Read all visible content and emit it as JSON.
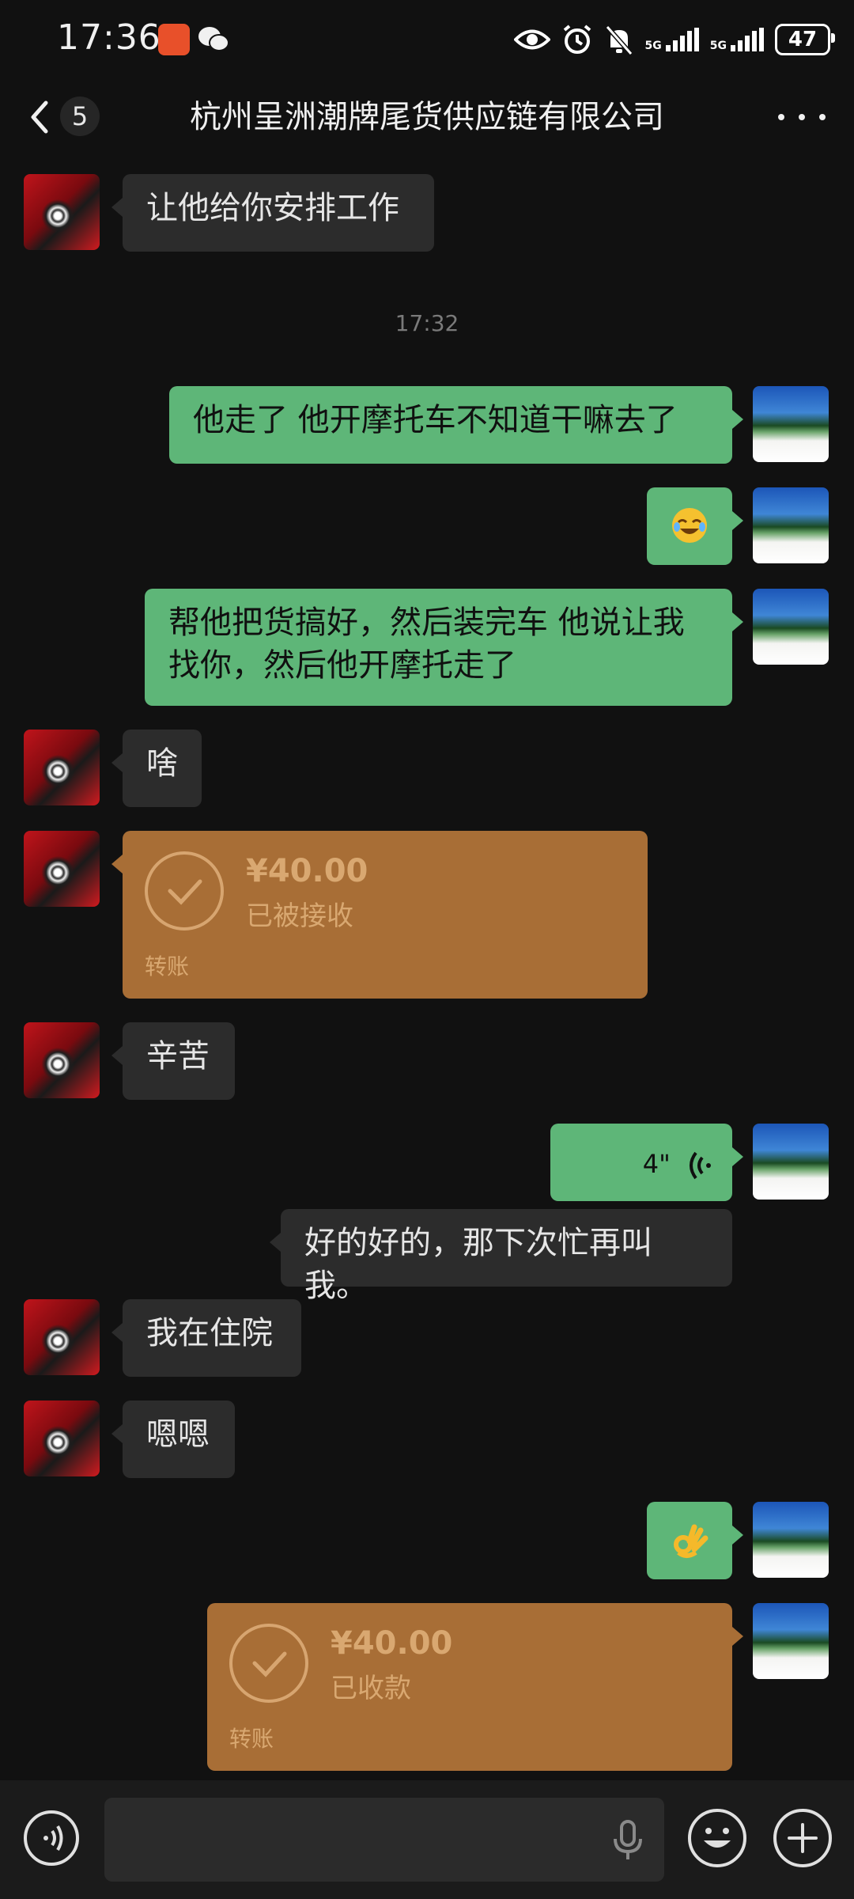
{
  "status_bar": {
    "time": "17:36",
    "network_1": "5G",
    "network_2": "5G",
    "battery": "47"
  },
  "header": {
    "unread_count": "5",
    "title": "杭州呈洲潮牌尾货供应链有限公司"
  },
  "messages": [
    {
      "from": "other",
      "text": "让他给你安排工作"
    },
    {
      "timestamp": "17:32"
    },
    {
      "from": "self",
      "text": "他走了  他开摩托车不知道干嘛去了"
    },
    {
      "from": "self",
      "emoji": "rolling-on-floor-laughing"
    },
    {
      "from": "self",
      "text_line1": "帮他把货搞好，然后装完车 他说让我",
      "text_line2": "找你，然后他开摩托走了"
    },
    {
      "from": "other",
      "text": "啥"
    },
    {
      "from": "other",
      "type": "transfer",
      "amount": "¥40.00",
      "status": "已被接收",
      "label": "转账"
    },
    {
      "from": "other",
      "text": "辛苦"
    },
    {
      "from": "self",
      "type": "voice",
      "duration": "4\""
    },
    {
      "from": "self",
      "type": "voice-transcript",
      "text": "好的好的，那下次忙再叫我。"
    },
    {
      "from": "other",
      "text": "我在住院"
    },
    {
      "from": "other",
      "text": "嗯嗯"
    },
    {
      "from": "self",
      "emoji": "ok-hand"
    },
    {
      "from": "self",
      "type": "transfer",
      "amount": "¥40.00",
      "status": "已收款",
      "label": "转账"
    }
  ],
  "colors": {
    "background": "#111111",
    "self_bubble": "#5eb678",
    "other_bubble": "#2c2c2c",
    "transfer_bubble": "#a86e36"
  }
}
